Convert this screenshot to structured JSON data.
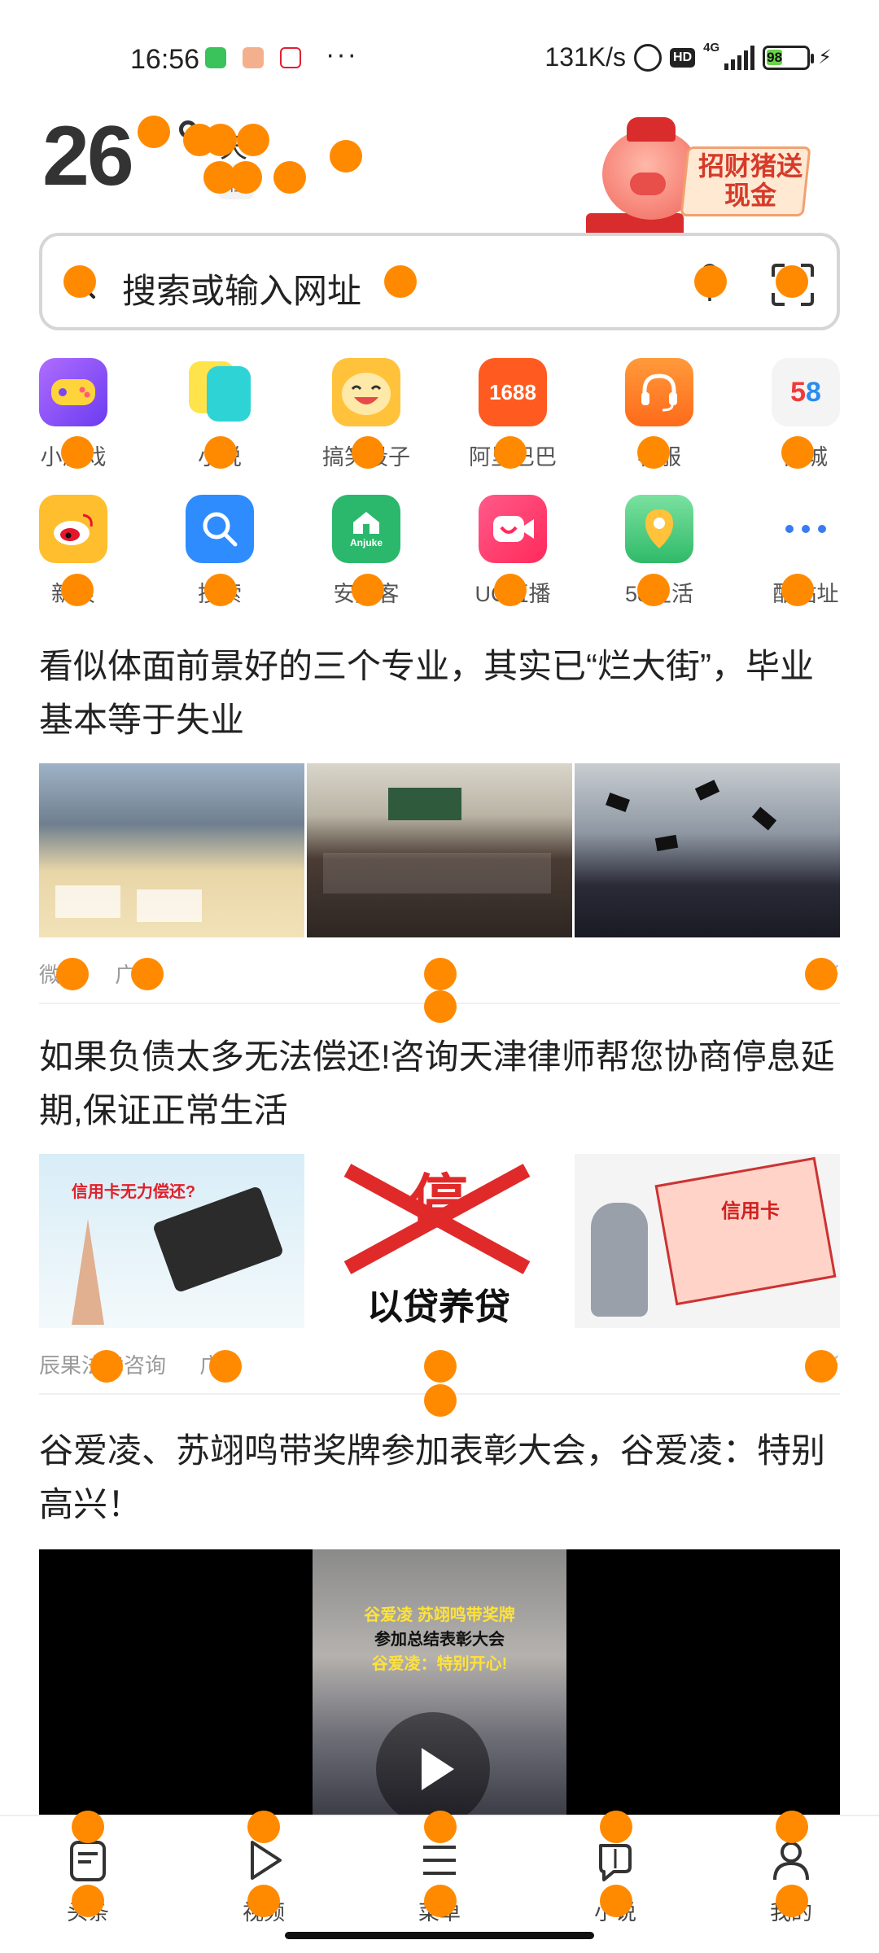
{
  "status_bar": {
    "time": "16:56",
    "dots": "···",
    "speed": "131K/s",
    "hd": "HD",
    "network": "4G",
    "battery": "98",
    "bolt": "⚡"
  },
  "weather": {
    "temperature": "26",
    "condition": "天",
    "aqi": "轻"
  },
  "promo": {
    "text": "招财猪送现金"
  },
  "search": {
    "placeholder": "搜索或输入网址"
  },
  "shortcuts": [
    {
      "label": "小游戏",
      "icon": "gamepad-icon",
      "color": "#8e5cf5"
    },
    {
      "label": "小说",
      "icon": "book-icon",
      "color": "#2ec9c9"
    },
    {
      "label": "搞笑段子",
      "icon": "laugh-face-icon",
      "color": "#ffc23a"
    },
    {
      "label": "阿里巴巴",
      "icon": "1688-icon",
      "color": "#ff5a1f",
      "text": "1688"
    },
    {
      "label": "客服",
      "icon": "headset-icon",
      "color": "#ff7a2a"
    },
    {
      "label": "同城",
      "icon": "58-icon",
      "color": "#f4f4f4",
      "text": "58"
    },
    {
      "label": "新浪",
      "icon": "weibo-icon",
      "color": "#ffbe2e"
    },
    {
      "label": "搜索",
      "icon": "magnifier-icon",
      "color": "#2f8cff"
    },
    {
      "label": "安居客",
      "icon": "anjuke-icon",
      "color": "#2bb86c",
      "text": "Anjuke"
    },
    {
      "label": "UC直播",
      "icon": "live-icon",
      "color": "#ff3a6b"
    },
    {
      "label": "58生活",
      "icon": "map-pin-icon",
      "color": "#36c277"
    },
    {
      "label": "酷站址",
      "icon": "more-dots-icon",
      "color": "#ffffff"
    }
  ],
  "feed": [
    {
      "title": "看似体面前景好的三个专业，其实已“烂大街”，毕业基本等于失业",
      "source": "微说",
      "tag": "广告",
      "close": "×"
    },
    {
      "title": "如果负债太多无法偿还!咨询天津律师帮您协商停息延期,保证正常生活",
      "source": "辰果法律咨询",
      "tag": "广告",
      "close": "×",
      "img_caption_1": "信用卡无力偿还?",
      "img_caption_2": "停",
      "img_caption_3": "以贷养贷",
      "img_caption_4": "信用卡"
    },
    {
      "title": "谷爱凌、苏翊鸣带奖牌参加表彰大会，谷爱凌：特别高兴！",
      "video_caption_1": "谷爱凌 苏翊鸣带奖牌",
      "video_caption_2": "参加总结表彰大会",
      "video_caption_3": "谷爱凌：特别开心!"
    }
  ],
  "bottom_nav": [
    {
      "label": "头条",
      "icon": "news-icon"
    },
    {
      "label": "视频",
      "icon": "play-icon"
    },
    {
      "label": "菜单",
      "icon": "menu-icon"
    },
    {
      "label": "小说",
      "icon": "book-icon"
    },
    {
      "label": "我的",
      "icon": "user-icon"
    }
  ],
  "colors": {
    "accent": "#ff8a00",
    "promo_red": "#d63a2a"
  }
}
